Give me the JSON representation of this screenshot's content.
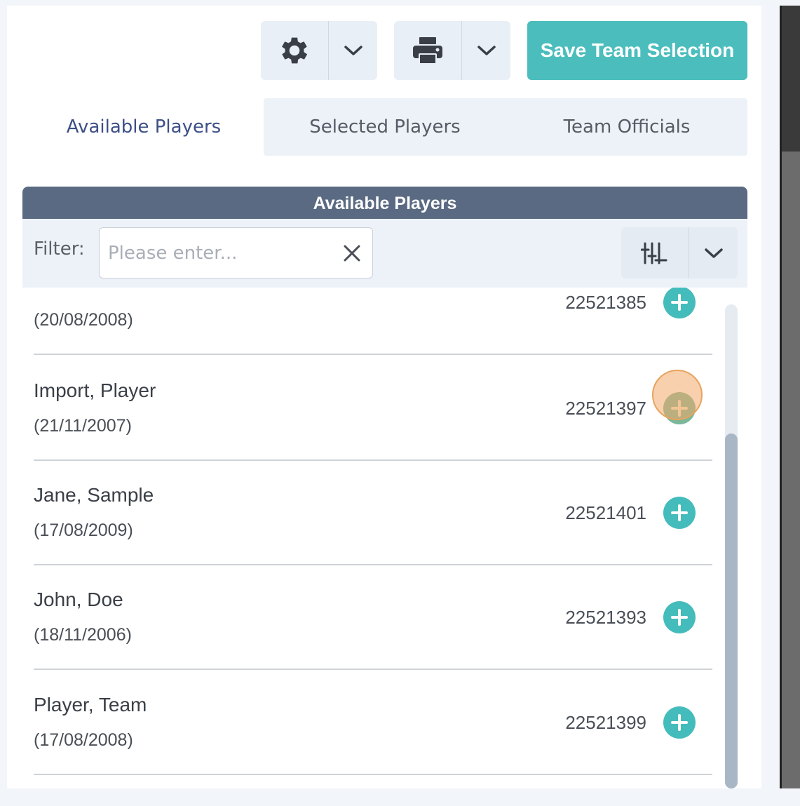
{
  "toolbar": {
    "settings_icon": "gear-icon",
    "print_icon": "printer-icon",
    "save_label": "Save Team Selection"
  },
  "tabs": [
    {
      "label": "Available Players",
      "active": true
    },
    {
      "label": "Selected Players",
      "active": false
    },
    {
      "label": "Team Officials",
      "active": false
    }
  ],
  "section": {
    "title": "Available Players",
    "filter_label": "Filter:",
    "filter_placeholder": "Please enter...",
    "filter_value": ""
  },
  "players": [
    {
      "name": "",
      "dob": "(20/08/2008)",
      "id": "22521385"
    },
    {
      "name": "Import, Player",
      "dob": "(21/11/2007)",
      "id": "22521397"
    },
    {
      "name": "Jane, Sample",
      "dob": "(17/08/2009)",
      "id": "22521401"
    },
    {
      "name": "John, Doe",
      "dob": "(18/11/2006)",
      "id": "22521393"
    },
    {
      "name": "Player, Team",
      "dob": "(17/08/2008)",
      "id": "22521399"
    }
  ],
  "colors": {
    "accent": "#4bbdbd",
    "header": "#5a6a82",
    "active_tab_text": "#3c4f86"
  }
}
